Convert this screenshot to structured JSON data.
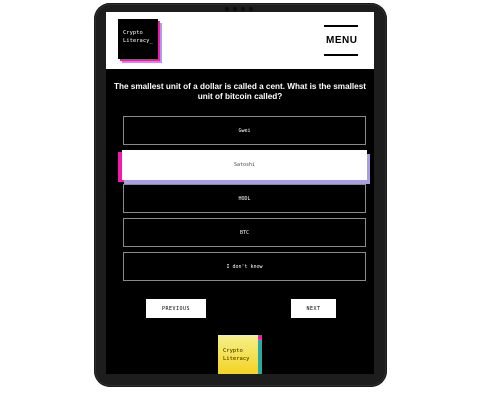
{
  "brand": {
    "logo_line1": "Crypto",
    "logo_line2": "Literacy_",
    "badge_line1": "Crypto",
    "badge_line2": "Literacy"
  },
  "header": {
    "menu_label": "MENU"
  },
  "quiz": {
    "question": "The smallest unit of a dollar is called a cent. What is the smallest unit of bitcoin called?",
    "options": [
      {
        "label": "Gwei",
        "selected": false
      },
      {
        "label": "Satoshi",
        "selected": true
      },
      {
        "label": "HODL",
        "selected": false
      },
      {
        "label": "BTC",
        "selected": false
      },
      {
        "label": "I don't know",
        "selected": false
      }
    ]
  },
  "nav": {
    "previous_label": "PREVIOUS",
    "next_label": "NEXT"
  },
  "colors": {
    "accent_pink": "#f21ba9",
    "accent_lavender": "#a99ce8",
    "badge_yellow": "#f4d21f",
    "background": "#000000"
  }
}
